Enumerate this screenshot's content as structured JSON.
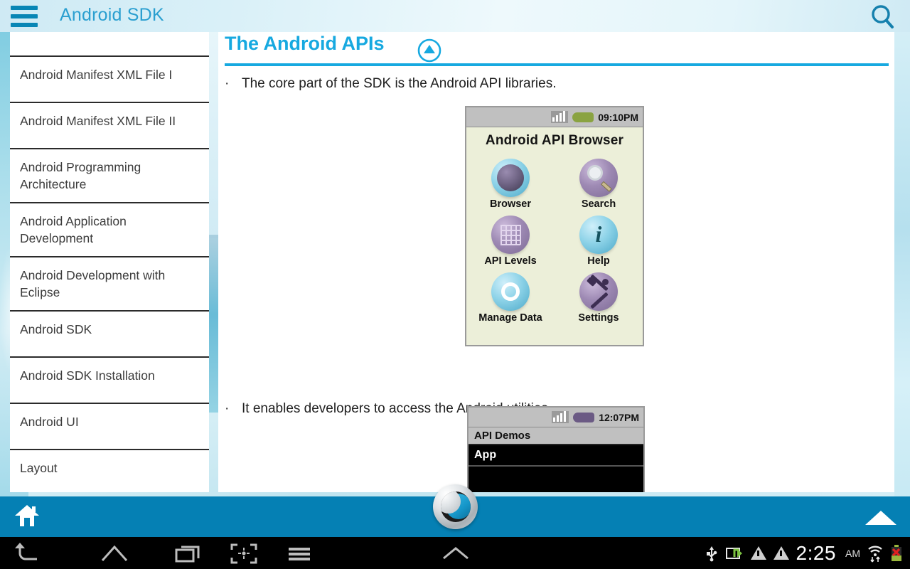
{
  "topbar": {
    "title": "Android SDK",
    "menu_icon": "hamburger-menu-icon",
    "search_icon": "search-icon"
  },
  "sidebar": {
    "items": [
      {
        "label": "",
        "partial": true
      },
      {
        "label": "Android Manifest XML File I"
      },
      {
        "label": "Android Manifest XML File II"
      },
      {
        "label": "Android Programming Architecture"
      },
      {
        "label": "Android Application Development"
      },
      {
        "label": "Android Development with Eclipse"
      },
      {
        "label": "Android SDK"
      },
      {
        "label": "Android SDK Installation"
      },
      {
        "label": "Android UI"
      },
      {
        "label": "Layout"
      }
    ]
  },
  "content": {
    "heading": "The Android APIs",
    "collapse_icon": "circle-up-arrow-icon",
    "bullets": [
      {
        "marker": "·",
        "text": "The core part of the SDK is the Android API libraries."
      },
      {
        "marker": "·",
        "text": "It enables developers to access the Android utilities."
      }
    ],
    "screenshot_one": {
      "status_time": "09:10PM",
      "title": "Android API Browser",
      "tiles": [
        {
          "label": "Browser",
          "icon": "globe-icon",
          "orb": "blue"
        },
        {
          "label": "Search",
          "icon": "magnifier-icon",
          "orb": "purple"
        },
        {
          "label": "API Levels",
          "icon": "table-grid-icon",
          "orb": "purple"
        },
        {
          "label": "Help",
          "icon": "info-i-icon",
          "orb": "blue"
        },
        {
          "label": "Manage Data",
          "icon": "ring-icon",
          "orb": "blue"
        },
        {
          "label": "Settings",
          "icon": "tools-icon",
          "orb": "purple"
        }
      ]
    },
    "screenshot_two": {
      "status_time": "12:07PM",
      "header_row": "API Demos",
      "selected_row": "App"
    }
  },
  "bottombar": {
    "home_icon": "home-icon",
    "up_icon": "up-triangle-icon",
    "logo_icon": "app-logo-icon"
  },
  "navbar": {
    "back_icon": "back-arrow-icon",
    "home_icon": "home-outline-icon",
    "recents_icon": "recent-apps-icon",
    "screenshot_icon": "screenshot-capture-icon",
    "menu_icon": "menu-lines-icon",
    "expand_icon": "chevron-up-icon",
    "status": {
      "usb_icon": "usb-icon",
      "transfer_icon": "data-transfer-icon",
      "warning_icon_1": "warning-triangle-icon",
      "warning_icon_2": "warning-triangle-icon",
      "time": "2:25",
      "ampm": "AM",
      "wifi_icon": "wifi-icon",
      "battery_icon": "battery-error-icon"
    }
  },
  "colors": {
    "accent": "#17a9e0",
    "brand_blue": "#0580b4",
    "title_blue": "#2a9fd0",
    "panel_bg": "#ffffff"
  }
}
